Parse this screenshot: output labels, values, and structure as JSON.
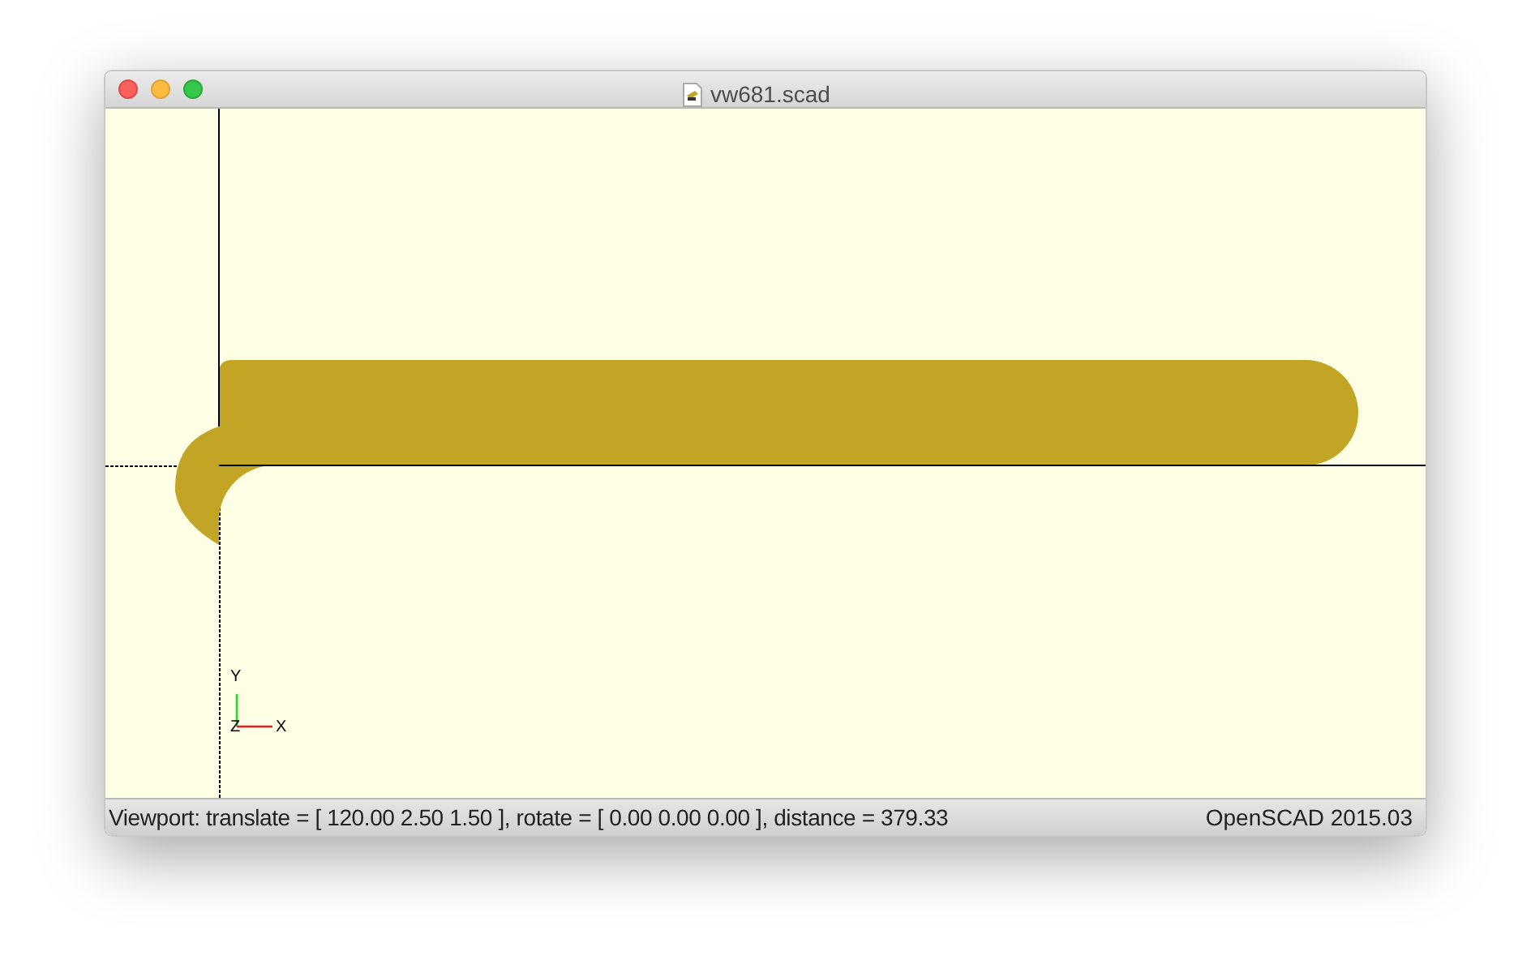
{
  "window": {
    "title": "vw681.scad"
  },
  "viewport": {
    "axis_labels": {
      "x": "X",
      "y": "Y",
      "z": "Z"
    }
  },
  "status_bar": {
    "viewport_info": "Viewport: translate = [ 120.00 2.50 1.50 ], rotate = [ 0.00 0.00 0.00 ], distance = 379.33",
    "version": "OpenSCAD 2015.03"
  }
}
